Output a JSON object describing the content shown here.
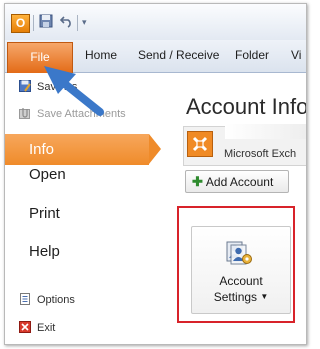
{
  "qat": {
    "app_icon_letter": "O",
    "icons": [
      "save-icon",
      "undo-icon",
      "customize-icon"
    ]
  },
  "ribbon": {
    "file_tab": "File",
    "tabs": [
      "Home",
      "Send / Receive",
      "Folder",
      "Vi"
    ]
  },
  "backstage": {
    "nav_small_top": [
      {
        "label": "Save As",
        "icon": "save-as-icon",
        "disabled": false
      },
      {
        "label": "Save Attachments",
        "icon": "save-attachments-icon",
        "disabled": true
      }
    ],
    "nav_big": [
      "Info",
      "Open",
      "Print",
      "Help"
    ],
    "selected": "Info",
    "nav_small_bottom": [
      {
        "label": "Options",
        "icon": "options-icon"
      },
      {
        "label": "Exit",
        "icon": "exit-icon"
      }
    ]
  },
  "main": {
    "title": "Account Info",
    "account_type": "Microsoft Exch",
    "add_account_label": "Add Account",
    "account_settings_line1": "Account",
    "account_settings_line2": "Settings"
  },
  "colors": {
    "file_tab": "#e36b17",
    "selection": "#ef8b2a",
    "highlight_box": "#d8232a",
    "pointer_arrow": "#3b78c9"
  }
}
